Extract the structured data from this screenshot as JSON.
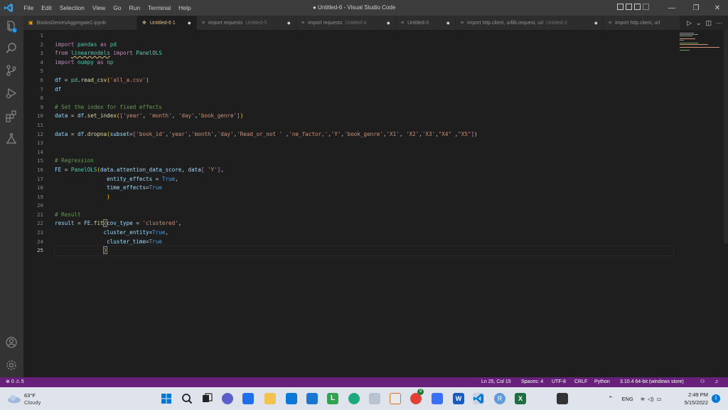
{
  "titlebar": {
    "menu": [
      "File",
      "Edit",
      "Selection",
      "View",
      "Go",
      "Run",
      "Terminal",
      "Help"
    ],
    "window_title": "● Untitled-6 - Visual Studio Code",
    "controls": {
      "minimize": "—",
      "restore": "❐",
      "close": "✕"
    }
  },
  "tabs": [
    {
      "label": "BooksGenresAggregate2.ipynb",
      "sub": "",
      "dirty": ""
    },
    {
      "label": "Untitled-6 1",
      "sub": "",
      "dirty": "●"
    },
    {
      "label": "import requests",
      "sub": "Untitled-5",
      "dirty": "●"
    },
    {
      "label": "import requests",
      "sub": "Untitled-4",
      "dirty": "●"
    },
    {
      "label": "Untitled-3",
      "sub": "",
      "dirty": "●"
    },
    {
      "label": "import http.client, urllib.request, url",
      "sub": "Untitled-2",
      "dirty": "●"
    },
    {
      "label": "import http.client, url",
      "sub": "",
      "dirty": ""
    }
  ],
  "tabs_actions": {
    "run": "▷",
    "chevron": "⌄",
    "split": "◫",
    "more": "···"
  },
  "editor": {
    "line_numbers": [
      "1",
      "2",
      "3",
      "4",
      "5",
      "6",
      "7",
      "8",
      "9",
      "10",
      "11",
      "12",
      "13",
      "14",
      "15",
      "16",
      "17",
      "18",
      "19",
      "20",
      "21",
      "22",
      "23",
      "24",
      "25"
    ],
    "current_line": 25
  },
  "statusbar": {
    "errors": "0",
    "warnings": "5",
    "position": "Ln 25, Col 15",
    "spaces": "Spaces: 4",
    "encoding": "UTF-8",
    "eol": "CRLF",
    "language": "Python",
    "interpreter": "3.10.4 64-bit (windows store)"
  },
  "taskbar": {
    "weather_temp": "63°F",
    "weather_desc": "Cloudy",
    "lang": "ENG",
    "time": "2:49 PM",
    "date": "5/15/2022",
    "notification_count": "9"
  },
  "colors": {
    "statusbar": "#68217a",
    "titlebar": "#3c3c3c",
    "activitybar": "#333333",
    "editor_bg": "#1e1e1e",
    "vscode_blue": "#0078d4"
  }
}
